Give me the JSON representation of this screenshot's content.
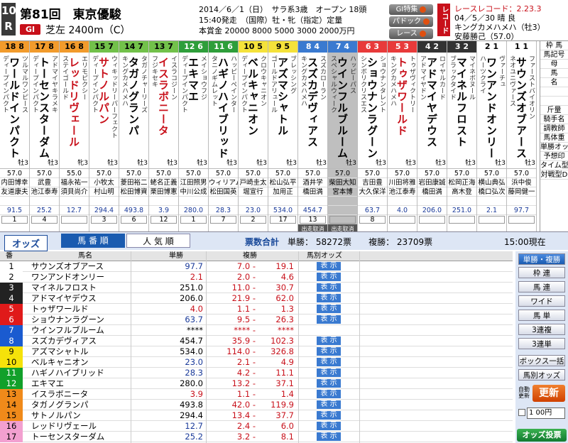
{
  "race": {
    "number": "10",
    "unit": "R",
    "title": "第81回　東京優駿",
    "grade": "GI",
    "course": "芝左 2400m（C）",
    "info1": "2014／6／1（日）　サラ系3歳　オープン 18頭",
    "info2": "15:40発走　（国際）牡・牝（指定）定量",
    "info3": "本賞金 20000 8000 5000 3000 2000万円"
  },
  "gi_buttons": [
    "GI特集",
    "パドック",
    "レース"
  ],
  "record": {
    "tag": "レコード",
    "line1": "レースレコード：2.23.3",
    "line2": "04／5／30 晴 良",
    "line3": "キングカメハメハ（牡3）",
    "line4": "安藤勝己（57.0）"
  },
  "horses": [
    {
      "waku": "18",
      "wn": "8",
      "name": "ワールドインパクト",
      "sire": "ディープインパクト",
      "dam": "ツルマルワンピース",
      "sex": "牡3",
      "kg": "57.0",
      "jockey": "内田博幸",
      "trainer": "友道康夫",
      "odds": "91.5",
      "rank": "1",
      "b1": "",
      "b2": "56.2",
      "wc": "#f29b2c",
      "tc": "#000",
      "hl": false
    },
    {
      "waku": "17",
      "wn": "8",
      "name": "トーセンスターダム",
      "sire": "ディープインパクト",
      "dam": "アドマイヤキラメキ",
      "sex": "牡3",
      "kg": "57.0",
      "jockey": "武豊",
      "trainer": "池江泰寿",
      "odds": "25.2",
      "rank": "4",
      "b1": "",
      "b2": "56.2",
      "wc": "#f29b2c",
      "tc": "#000",
      "hl": false
    },
    {
      "waku": "16",
      "wn": "8",
      "name": "レッドリヴェール",
      "sire": "ステイゴールド",
      "dam": "エリモピクシー",
      "sex": "牝3",
      "kg": "55.0",
      "jockey": "福永祐一",
      "trainer": "須貝尚介",
      "odds": "12.7",
      "rank": "",
      "b1": "",
      "b2": "61.0",
      "wc": "#f29b2c",
      "tc": "#c8101a",
      "hl": false
    },
    {
      "waku": "15",
      "wn": "7",
      "name": "サトノルパン",
      "sire": "ディープインパクト",
      "dam": "ウィキッドリーパーフェクト",
      "sex": "牡3",
      "kg": "57.0",
      "jockey": "小牧太",
      "trainer": "村山明",
      "odds": "294.4",
      "rank": "3",
      "b1": "",
      "b2": "50.4",
      "wc": "#72c14a",
      "tc": "#c8101a",
      "hl": false
    },
    {
      "waku": "14",
      "wn": "7",
      "name": "タガノグランパ",
      "sire": "キングカメハメハ",
      "dam": "タガノチャーリーズ",
      "sex": "牡3",
      "kg": "57.0",
      "jockey": "菱田裕二",
      "trainer": "松田博資",
      "odds": "493.8",
      "rank": "6",
      "b1": "",
      "b2": "47.1",
      "wc": "#72c14a",
      "tc": "#000",
      "hl": false
    },
    {
      "waku": "13",
      "wn": "7",
      "name": "イスラボニータ",
      "sire": "フジキセキ",
      "dam": "イスラコジーン",
      "sex": "牡3",
      "kg": "57.0",
      "jockey": "蛯名正義",
      "trainer": "栗田博憲",
      "odds": "3.9",
      "rank": "12",
      "b1": "",
      "b2": "66.5",
      "wc": "#72c14a",
      "tc": "#c8101a",
      "hl": false
    },
    {
      "waku": "12",
      "wn": "6",
      "name": "エキマエ",
      "sire": "ディープインパクト",
      "dam": "メイショウフジ",
      "sex": "牡3",
      "kg": "57.0",
      "jockey": "江田照男",
      "trainer": "中川公成",
      "odds": "280.0",
      "rank": "1",
      "b1": "",
      "b2": "12.5",
      "wc": "#2e9e3a",
      "tc": "#000",
      "hl": false
    },
    {
      "waku": "11",
      "wn": "6",
      "name": "ハギノハイブリッド",
      "sire": "タニノギムレット",
      "dam": "ハッピーペインター",
      "sex": "牡3",
      "kg": "57.0",
      "jockey": "ウィリアム",
      "trainer": "松田国英",
      "odds": "28.3",
      "rank": "7",
      "b1": "",
      "b2": "56.5",
      "wc": "#2e9e3a",
      "tc": "#000",
      "hl": false
    },
    {
      "waku": "10",
      "wn": "5",
      "name": "ベルキャニオン",
      "sire": "ディープインパクト",
      "dam": "クロウキャニオン",
      "sex": "牡3",
      "kg": "57.0",
      "jockey": "戸崎圭太",
      "trainer": "堀宣行",
      "odds": "23.0",
      "rank": "2",
      "b1": "",
      "b2": "52.3",
      "wc": "#f5e23a",
      "tc": "#000",
      "hl": false
    },
    {
      "waku": "9",
      "wn": "5",
      "name": "アズマシャトル",
      "sire": "ゴールドアリュール",
      "dam": "ブレッシング",
      "sex": "牡3",
      "kg": "57.0",
      "jockey": "松山弘平",
      "trainer": "加用正",
      "odds": "534.0",
      "rank": "17",
      "b1": "",
      "b2": "31.2",
      "wc": "#f5e23a",
      "tc": "#000",
      "hl": false
    },
    {
      "waku": "8",
      "wn": "4",
      "name": "スズカデヴィアス",
      "sire": "キングカメハメハ",
      "dam": "スズカローラン",
      "sex": "牡3",
      "kg": "57.0",
      "jockey": "酒井学",
      "trainer": "橋田満",
      "odds": "454.7",
      "rank": "13",
      "b1": "出走取消",
      "b2": "42.2",
      "wc": "#3a7ad0",
      "tc": "#000",
      "hl": false
    },
    {
      "waku": "7",
      "wn": "4",
      "name": "ウインフルブルーム",
      "sire": "スペシャルウィーク",
      "dam": "ハッピーパス",
      "sex": "牡3",
      "kg": "57.0",
      "jockey": "柴田大知",
      "trainer": "宮本博",
      "odds": "",
      "rank": "",
      "b1": "出走取消",
      "b2": "",
      "wc": "#3a7ad0",
      "tc": "#000",
      "hl": true
    },
    {
      "waku": "6",
      "wn": "3",
      "name": "ショウナンラグーン",
      "sire": "シンボリクリスエス",
      "dam": "ショウナンタレント",
      "sex": "牡3",
      "kg": "57.0",
      "jockey": "吉田豊",
      "trainer": "大久保洋",
      "odds": "63.7",
      "rank": "8",
      "b1": "",
      "b2": "48.3",
      "wc": "#e83a3a",
      "tc": "#000",
      "hl": false
    },
    {
      "waku": "5",
      "wn": "3",
      "name": "トゥザワールド",
      "sire": "キングカメハメハ",
      "dam": "トゥザヴィクトリー",
      "sex": "牡3",
      "kg": "57.0",
      "jockey": "川田将雅",
      "trainer": "池江泰寿",
      "odds": "4.0",
      "rank": "",
      "b1": "",
      "b2": "59.7",
      "wc": "#e83a3a",
      "tc": "#c8101a",
      "hl": false
    },
    {
      "waku": "4",
      "wn": "2",
      "name": "アドマイヤデウス",
      "sire": "アドマイヤドン",
      "dam": "ロイヤルカード",
      "sex": "牡3",
      "kg": "57.0",
      "jockey": "岩田康誠",
      "trainer": "橋田満",
      "odds": "206.0",
      "rank": "",
      "b1": "",
      "b2": "55.8",
      "wc": "#333",
      "tc": "#000",
      "hl": false
    },
    {
      "waku": "3",
      "wn": "2",
      "name": "マイネルフロスト",
      "sire": "ブラックタイド",
      "dam": "マイネボヌール",
      "sex": "牡3",
      "kg": "57.0",
      "jockey": "松岡正海",
      "trainer": "高木登",
      "odds": "251.0",
      "rank": "",
      "b1": "",
      "b2": "45.8",
      "wc": "#333",
      "tc": "#000",
      "hl": false
    },
    {
      "waku": "2",
      "wn": "1",
      "name": "ワンアンドオンリー",
      "sire": "ハーツクライ",
      "dam": "ヴァーチュ",
      "sex": "牡3",
      "kg": "57.0",
      "jockey": "横山典弘",
      "trainer": "橋口弘次",
      "odds": "2.1",
      "rank": "",
      "b1": "",
      "b2": "50.9",
      "wc": "#fff",
      "tc": "#000",
      "hl": false
    },
    {
      "waku": "1",
      "wn": "1",
      "name": "サウンズオブアース",
      "sire": "ネオユニヴァース",
      "dam": "ファーストバイオリン",
      "sex": "牡3",
      "kg": "57.0",
      "jockey": "浜中俊",
      "trainer": "藤岡健一",
      "odds": "97.7",
      "rank": "",
      "b1": "",
      "b2": "53.0",
      "wc": "#fff",
      "tc": "#000",
      "hl": false
    }
  ],
  "side_labels": [
    "枠 馬",
    "馬記号",
    "母",
    "馬",
    "名",
    "",
    "",
    "斤量",
    "騎手名",
    "調教師",
    "馬体重",
    "単勝オッズ",
    "予想印",
    "タイム型D",
    "対戦型D"
  ],
  "cancel_label": "出走取消",
  "odds_bar": {
    "tag": "オッズ",
    "tab1": "馬 番 順",
    "tab2": "人 気 順",
    "total_label": "票数合計",
    "tan_label": "単勝：",
    "tan_votes": "58272票",
    "fuku_label": "複勝：",
    "fuku_votes": "23709票",
    "time": "15:00現在"
  },
  "odds_header": {
    "num": "番",
    "name": "馬名",
    "tan": "単勝",
    "fuku": "複勝",
    "umabetsu": "馬別オッズ"
  },
  "show_label": "表 示",
  "odds_rows": [
    {
      "num": "1",
      "name": "サウンズオブアース",
      "tan": "97.7",
      "f1": "7.0 -",
      "f2": "19.1",
      "bg": "#fff",
      "fc": "#000",
      "tc": "#1a3a9a"
    },
    {
      "num": "2",
      "name": "ワンアンドオンリー",
      "tan": "2.1",
      "f1": "2.0 -",
      "f2": "4.6",
      "bg": "#fff",
      "fc": "#000",
      "tc": "#c8101a"
    },
    {
      "num": "3",
      "name": "マイネルフロスト",
      "tan": "251.0",
      "f1": "11.0 -",
      "f2": "30.7",
      "bg": "#222",
      "fc": "#fff",
      "tc": "#000"
    },
    {
      "num": "4",
      "name": "アドマイヤデウス",
      "tan": "206.0",
      "f1": "21.9 -",
      "f2": "62.0",
      "bg": "#222",
      "fc": "#fff",
      "tc": "#000"
    },
    {
      "num": "5",
      "name": "トゥザワールド",
      "tan": "4.0",
      "f1": "1.1 -",
      "f2": "1.3",
      "bg": "#e01a1a",
      "fc": "#fff",
      "tc": "#c8101a"
    },
    {
      "num": "6",
      "name": "ショウナンラグーン",
      "tan": "63.7",
      "f1": "9.5 -",
      "f2": "26.3",
      "bg": "#e01a1a",
      "fc": "#fff",
      "tc": "#1a3a9a"
    },
    {
      "num": "7",
      "name": "ウインフルブルーム",
      "tan": "****",
      "f1": "**** -",
      "f2": "****",
      "bg": "#1a5bd0",
      "fc": "#fff",
      "tc": "#000"
    },
    {
      "num": "8",
      "name": "スズカデヴィアス",
      "tan": "454.7",
      "f1": "35.9 -",
      "f2": "102.3",
      "bg": "#1a5bd0",
      "fc": "#fff",
      "tc": "#000"
    },
    {
      "num": "9",
      "name": "アズマシャトル",
      "tan": "534.0",
      "f1": "114.0 -",
      "f2": "326.8",
      "bg": "#f5e20a",
      "fc": "#000",
      "tc": "#000"
    },
    {
      "num": "10",
      "name": "ベルキャニオン",
      "tan": "23.0",
      "f1": "2.1 -",
      "f2": "4.9",
      "bg": "#f5e20a",
      "fc": "#000",
      "tc": "#1a3a9a"
    },
    {
      "num": "11",
      "name": "ハギノハイブリッド",
      "tan": "28.3",
      "f1": "4.2 -",
      "f2": "11.1",
      "bg": "#12a02a",
      "fc": "#fff",
      "tc": "#1a3a9a"
    },
    {
      "num": "12",
      "name": "エキマエ",
      "tan": "280.0",
      "f1": "13.2 -",
      "f2": "37.1",
      "bg": "#12a02a",
      "fc": "#fff",
      "tc": "#000"
    },
    {
      "num": "13",
      "name": "イスラボニータ",
      "tan": "3.9",
      "f1": "1.1 -",
      "f2": "1.4",
      "bg": "#f08a1a",
      "fc": "#000",
      "tc": "#c8101a"
    },
    {
      "num": "14",
      "name": "タガノグランパ",
      "tan": "493.8",
      "f1": "42.0 -",
      "f2": "119.9",
      "bg": "#f08a1a",
      "fc": "#000",
      "tc": "#000"
    },
    {
      "num": "15",
      "name": "サトノルパン",
      "tan": "294.4",
      "f1": "13.4 -",
      "f2": "37.7",
      "bg": "#f08a1a",
      "fc": "#000",
      "tc": "#000"
    },
    {
      "num": "16",
      "name": "レッドリヴェール",
      "tan": "12.7",
      "f1": "2.4 -",
      "f2": "6.0",
      "bg": "#f2a0d0",
      "fc": "#000",
      "tc": "#1a3a9a"
    },
    {
      "num": "17",
      "name": "トーセンスターダム",
      "tan": "25.2",
      "f1": "3.2 -",
      "f2": "8.1",
      "bg": "#f2a0d0",
      "fc": "#000",
      "tc": "#1a3a9a"
    }
  ],
  "right_buttons": [
    "単勝・複勝",
    "枠 連",
    "馬 連",
    "ワイド",
    "馬 単",
    "3連複",
    "3連単",
    "ボックス一括",
    "馬別オッズ"
  ],
  "auto_label": "自動更新",
  "update_label": "更新",
  "amount": "1 00円",
  "vote_label": "オッズ投票"
}
